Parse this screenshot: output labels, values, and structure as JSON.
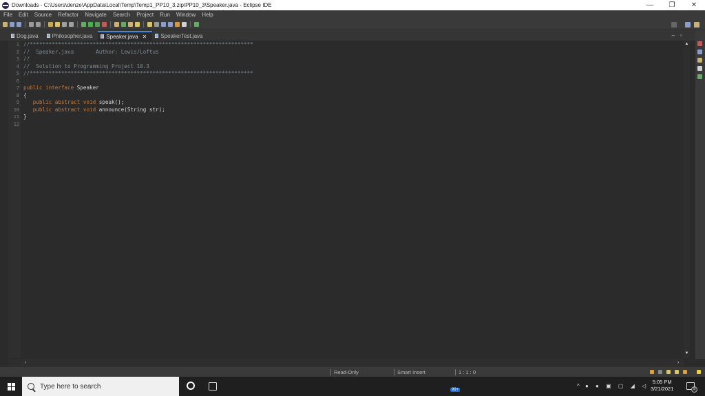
{
  "window": {
    "title": "Downloads - C:\\Users\\denze\\AppData\\Local\\Temp\\Temp1_PP10_3.zip\\PP10_3\\Speaker.java - Eclipse IDE",
    "minimize": "—",
    "maximize": "❐",
    "close": "✕"
  },
  "menu": [
    "File",
    "Edit",
    "Source",
    "Refactor",
    "Navigate",
    "Search",
    "Project",
    "Run",
    "Window",
    "Help"
  ],
  "tabs": [
    {
      "label": "Dog.java"
    },
    {
      "label": "Philosopher.java"
    },
    {
      "label": "Speaker.java",
      "active": true
    },
    {
      "label": "SpeakerTest.java"
    }
  ],
  "editor": {
    "lines": [
      {
        "num": "1",
        "tokens": [
          {
            "t": "c",
            "s": "//***********************************************************************"
          }
        ]
      },
      {
        "num": "2",
        "tokens": [
          {
            "t": "c",
            "s": "//  Speaker.java       Author: Lewis/Loftus"
          }
        ]
      },
      {
        "num": "3",
        "tokens": [
          {
            "t": "c",
            "s": "//"
          }
        ]
      },
      {
        "num": "4",
        "tokens": [
          {
            "t": "c",
            "s": "//  Solution to Programming Project 10.3"
          }
        ]
      },
      {
        "num": "5",
        "tokens": [
          {
            "t": "c",
            "s": "//***********************************************************************"
          }
        ]
      },
      {
        "num": "6",
        "tokens": []
      },
      {
        "num": "7",
        "tokens": [
          {
            "t": "k",
            "s": "public interface "
          },
          {
            "t": "p",
            "s": "Speaker"
          }
        ]
      },
      {
        "num": "8",
        "tokens": [
          {
            "t": "p",
            "s": "{"
          }
        ]
      },
      {
        "num": "9",
        "tokens": [
          {
            "t": "p",
            "s": "   "
          },
          {
            "t": "k",
            "s": "public abstract void "
          },
          {
            "t": "p",
            "s": "speak();"
          }
        ]
      },
      {
        "num": "10",
        "tokens": [
          {
            "t": "p",
            "s": "   "
          },
          {
            "t": "k",
            "s": "public abstract void "
          },
          {
            "t": "p",
            "s": "announce(String str);"
          }
        ]
      },
      {
        "num": "11",
        "tokens": [
          {
            "t": "p",
            "s": "}"
          }
        ]
      },
      {
        "num": "12",
        "tokens": []
      }
    ]
  },
  "status": {
    "mode": "Read-Only",
    "insert": "Smart Insert",
    "position": "1 : 1 : 0"
  },
  "taskbar": {
    "search_placeholder": "Type here to search",
    "time": "5:05 PM",
    "date": "3/21/2021",
    "notification_count": "9",
    "badge": "99+"
  },
  "colors": {
    "accent": "#4a88d8",
    "keyword": "#cc7832",
    "comment": "#7d8c93"
  }
}
